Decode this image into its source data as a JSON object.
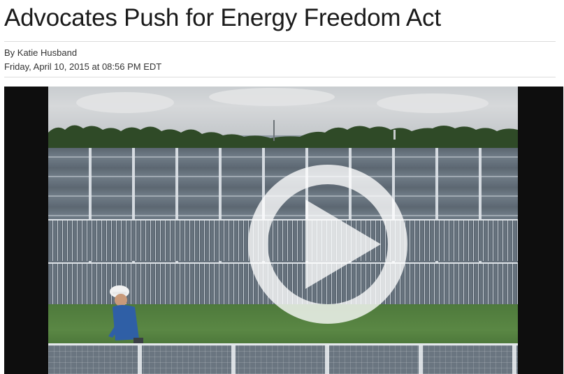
{
  "article": {
    "headline": "Advocates Push for Energy Freedom Act",
    "byline": "By Katie Husband",
    "dateline": "Friday, April 10, 2015 at 08:56 PM EDT"
  },
  "video": {
    "play_icon": "play-icon",
    "scene": "solar-farm"
  }
}
